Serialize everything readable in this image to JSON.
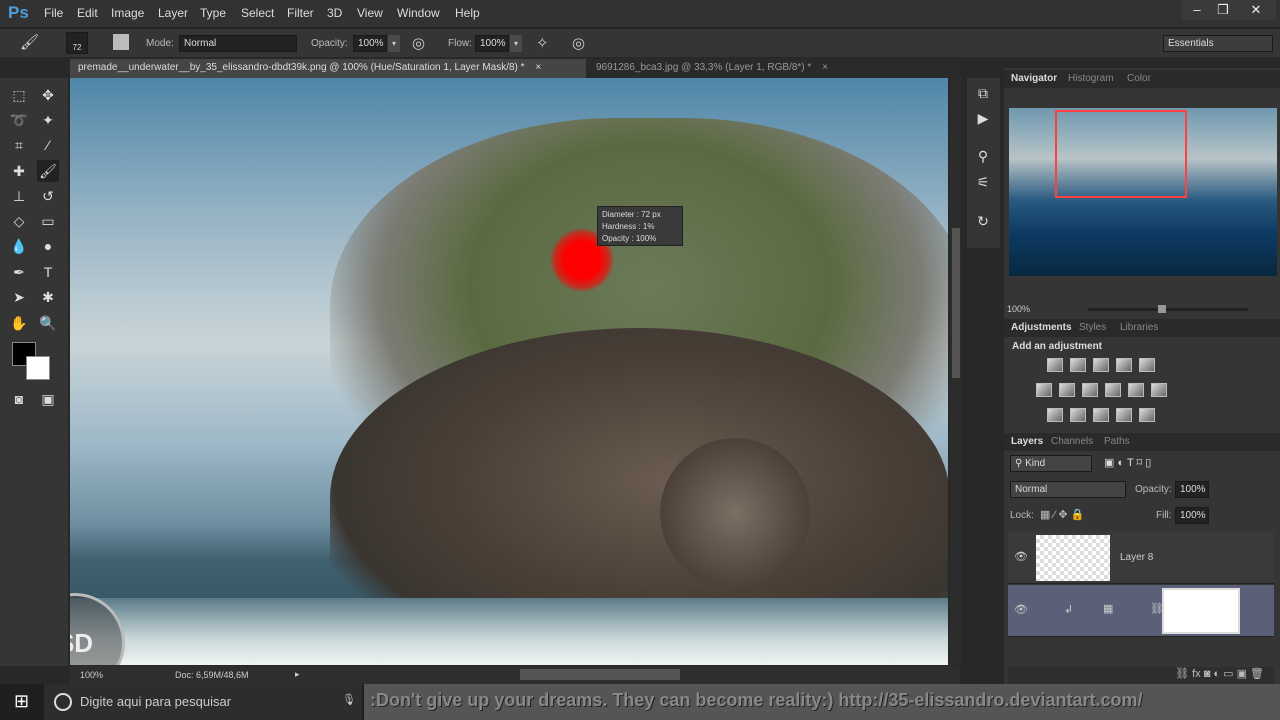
{
  "app": {
    "logo": "Ps",
    "menus": [
      "File",
      "Edit",
      "Image",
      "Layer",
      "Type",
      "Select",
      "Filter",
      "3D",
      "View",
      "Window",
      "Help"
    ],
    "window_controls": [
      "minimize",
      "restore",
      "close"
    ]
  },
  "options": {
    "brush_size": "72",
    "mode_label": "Mode:",
    "mode_value": "Normal",
    "opacity_label": "Opacity:",
    "opacity_value": "100%",
    "flow_label": "Flow:",
    "flow_value": "100%",
    "workspace": "Essentials"
  },
  "tabs": [
    {
      "label": "premade__underwater__by_35_elissandro-dbdt39k.png @ 100% (Hue/Saturation 1, Layer Mask/8) *",
      "active": true
    },
    {
      "label": "9691286_bca3.jpg @ 33,3% (Layer 1, RGB/8*) *",
      "active": false
    }
  ],
  "tooltip": {
    "diameter_label": "Diameter :",
    "diameter": "72 px",
    "hardness_label": "Hardness :",
    "hardness": "1%",
    "opacity_label": "Opacity :",
    "opacity": "100%"
  },
  "status": {
    "zoom": "100%",
    "doc": "Doc: 6,59M/48,6M"
  },
  "navigator": {
    "tabs": [
      "Navigator",
      "Histogram",
      "Color"
    ],
    "zoom": "100%"
  },
  "adjustments": {
    "tabs": [
      "Adjustments",
      "Styles",
      "Libraries"
    ],
    "heading": "Add an adjustment"
  },
  "layers_panel": {
    "tabs": [
      "Layers",
      "Channels",
      "Paths"
    ],
    "filter": "Kind",
    "blend": "Normal",
    "opacity_label": "Opacity:",
    "opacity": "100%",
    "lock_label": "Lock:",
    "fill_label": "Fill:",
    "fill": "100%",
    "layers": [
      {
        "name": "Layer 8"
      },
      {
        "name": ""
      }
    ]
  },
  "taskbar": {
    "search_placeholder": "Digite aqui para pesquisar",
    "banner": ":Don't give up your dreams. They can become reality:) http://35-elissandro.deviantart.com/"
  },
  "watermark": "SD"
}
